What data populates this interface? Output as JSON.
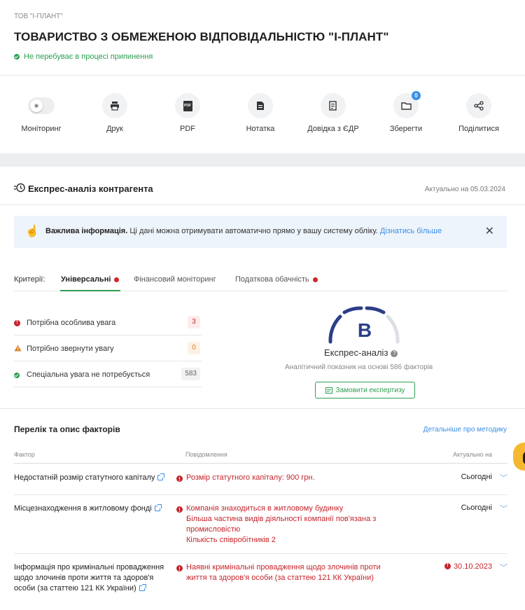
{
  "company": {
    "short_name": "ТОВ \"І-ПЛАНТ\"",
    "full_name": "ТОВАРИСТВО З ОБМЕЖЕНОЮ ВІДПОВІДАЛЬНІСТЮ \"І-ПЛАНТ\"",
    "status": "Не перебуває в процесі припинення"
  },
  "toolbar": {
    "monitoring": "Моніторинг",
    "print": "Друк",
    "pdf": "PDF",
    "pdf_icon_text": "PDF",
    "note": "Нотатка",
    "edr": "Довідка з ЄДР",
    "save": "Зберегти",
    "save_badge": "0",
    "share": "Поділитися"
  },
  "express": {
    "title": "Експрес-аналіз контрагента",
    "actual": "Актуально на 05.03.2024",
    "info_bold": "Важлива інформація.",
    "info_text": " Ці дані можна отримувати автоматично прямо у вашу систему обліку.",
    "info_link": "Дізнатись більше",
    "criteria_label": "Критерії:",
    "tabs": [
      "Універсальні",
      "Фінансовий моніторинг",
      "Податкова обачність"
    ],
    "attention": [
      {
        "label": "Потрібна особлива увага",
        "count": "3"
      },
      {
        "label": "Потрібно звернути увагу",
        "count": "0"
      },
      {
        "label": "Спеціальна увага не потребується",
        "count": "583"
      }
    ],
    "grade": "B",
    "analysis_title": "Експрес-аналіз",
    "analysis_sub": "Аналітичний показник на основі 586 факторів",
    "order_button": "Замовити експертизу",
    "colors": {
      "accent": "#2e9e52",
      "grade": "#2b3e87",
      "danger": "#c5242b",
      "link": "#3a8ee6"
    }
  },
  "factors": {
    "title": "Перелік та опис факторів",
    "method_link": "Детальніше про методику",
    "headers": {
      "factor": "Фактор",
      "message": "Повідомлення",
      "actual": "Актуально на"
    },
    "rows": [
      {
        "factor": "Недостатній розмір статутного капіталу",
        "messages": [
          "Розмір статутного капіталу: 900 грн."
        ],
        "actual": "Сьогодні"
      },
      {
        "factor": "Місцезнаходження в житловому фонді",
        "messages": [
          "Компанія знаходиться в житловому будинку",
          "Більша частина видів діяльності компанії пов'язана з промисловістю",
          "Кількість співробітників 2"
        ],
        "actual": "Сьогодні"
      },
      {
        "factor": "Інформація про кримінальні провадження щодо злочинів проти життя та здоров'я особи (за статтею 121 КК України)",
        "messages": [
          "Наявні кримінальні провадження щодо злочинів проти життя та здоров'я особи (за статтею 121 КК України)"
        ],
        "actual": "30.10.2023"
      }
    ]
  }
}
